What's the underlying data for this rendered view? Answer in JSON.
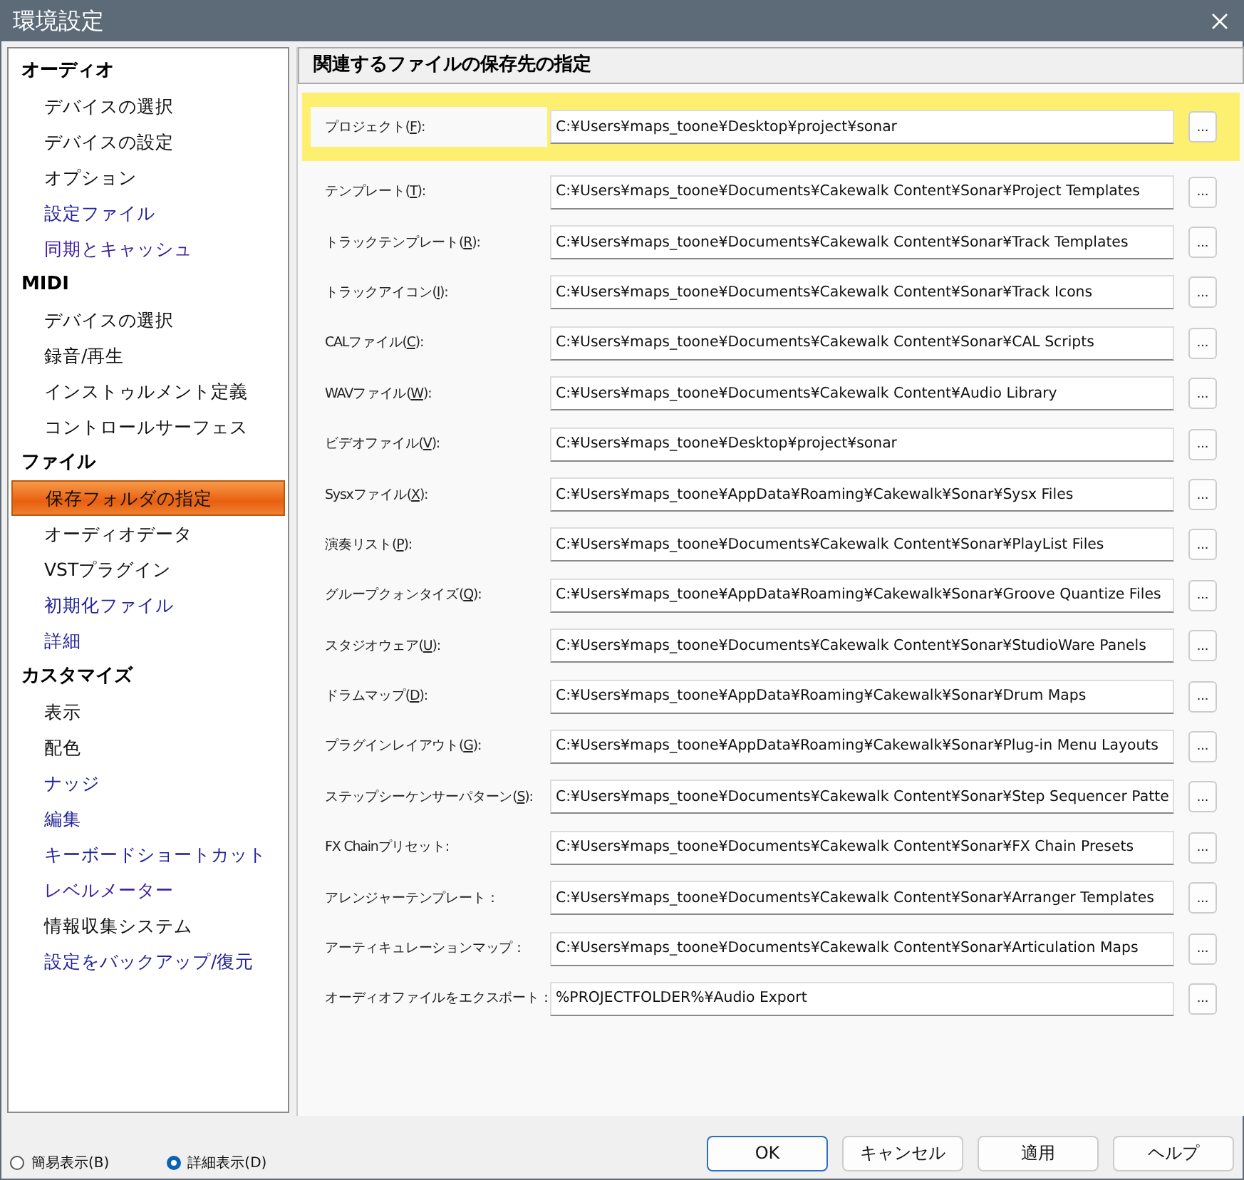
{
  "window": {
    "title": "環境設定"
  },
  "sidebar": {
    "groups": [
      {
        "label": "オーディオ",
        "items": [
          {
            "label": "デバイスの選択",
            "selected": false,
            "color": "#111111"
          },
          {
            "label": "デバイスの設定",
            "selected": false,
            "color": "#111111"
          },
          {
            "label": "オプション",
            "selected": false,
            "color": "#111111"
          },
          {
            "label": "設定ファイル",
            "selected": false,
            "color": "#22229a"
          },
          {
            "label": "同期とキャッシュ",
            "selected": false,
            "color": "#3a1a9a"
          }
        ]
      },
      {
        "label": "MIDI",
        "items": [
          {
            "label": "デバイスの選択",
            "selected": false,
            "color": "#111111"
          },
          {
            "label": "録音/再生",
            "selected": false,
            "color": "#111111"
          },
          {
            "label": "インストゥルメント定義",
            "selected": false,
            "color": "#111111"
          },
          {
            "label": "コントロールサーフェス",
            "selected": false,
            "color": "#111111"
          }
        ]
      },
      {
        "label": "ファイル",
        "items": [
          {
            "label": "保存フォルダの指定",
            "selected": true
          },
          {
            "label": "オーディオデータ",
            "selected": false,
            "color": "#111111"
          },
          {
            "label": "VSTプラグイン",
            "selected": false,
            "color": "#111111"
          },
          {
            "label": "初期化ファイル",
            "selected": false,
            "color": "#22229a"
          },
          {
            "label": "詳細",
            "selected": false,
            "color": "#22229a"
          }
        ]
      },
      {
        "label": "カスタマイズ",
        "items": [
          {
            "label": "表示",
            "selected": false,
            "color": "#111111"
          },
          {
            "label": "配色",
            "selected": false,
            "color": "#111111"
          },
          {
            "label": "ナッジ",
            "selected": false,
            "color": "#22229a"
          },
          {
            "label": "編集",
            "selected": false,
            "color": "#22229a"
          },
          {
            "label": "キーボードショートカット",
            "selected": false,
            "color": "#22229a"
          },
          {
            "label": "レベルメーター",
            "selected": false,
            "color": "#3a1a9a"
          },
          {
            "label": "情報収集システム",
            "selected": false,
            "color": "#111111"
          },
          {
            "label": "設定をバックアップ/復元",
            "selected": false,
            "color": "#22229a"
          }
        ]
      }
    ]
  },
  "panel": {
    "title": "関連するファイルの保存先の指定",
    "rows": [
      {
        "label": "プロジェクト(",
        "key": "F",
        "after": "):",
        "value": "C:¥Users¥maps_toone¥Desktop¥project¥sonar",
        "highlighted": true,
        "button": "..."
      },
      {
        "label": "テンプレート(",
        "key": "T",
        "after": "):",
        "value": "C:¥Users¥maps_toone¥Documents¥Cakewalk Content¥Sonar¥Project Templates",
        "highlighted": false,
        "button": "..."
      },
      {
        "label": "トラックテンプレート(",
        "key": "R",
        "after": "):",
        "value": "C:¥Users¥maps_toone¥Documents¥Cakewalk Content¥Sonar¥Track Templates",
        "highlighted": false,
        "button": "..."
      },
      {
        "label": "トラックアイコン(",
        "key": "I",
        "after": "):",
        "value": "C:¥Users¥maps_toone¥Documents¥Cakewalk Content¥Sonar¥Track Icons",
        "highlighted": false,
        "button": "..."
      },
      {
        "label": "CALファイル(",
        "key": "C",
        "after": "):",
        "value": "C:¥Users¥maps_toone¥Documents¥Cakewalk Content¥Sonar¥CAL Scripts",
        "highlighted": false,
        "button": "..."
      },
      {
        "label": "WAVファイル(",
        "key": "W",
        "after": "):",
        "value": "C:¥Users¥maps_toone¥Documents¥Cakewalk Content¥Audio Library",
        "highlighted": false,
        "button": "..."
      },
      {
        "label": "ビデオファイル(",
        "key": "V",
        "after": "):",
        "value": "C:¥Users¥maps_toone¥Desktop¥project¥sonar",
        "highlighted": false,
        "button": "..."
      },
      {
        "label": "Sysxファイル(",
        "key": "X",
        "after": "):",
        "value": "C:¥Users¥maps_toone¥AppData¥Roaming¥Cakewalk¥Sonar¥Sysx Files",
        "highlighted": false,
        "button": "..."
      },
      {
        "label": "演奏リスト(",
        "key": "P",
        "after": "):",
        "value": "C:¥Users¥maps_toone¥Documents¥Cakewalk Content¥Sonar¥PlayList Files",
        "highlighted": false,
        "button": "..."
      },
      {
        "label": "グループクォンタイズ(",
        "key": "Q",
        "after": "):",
        "value": "C:¥Users¥maps_toone¥AppData¥Roaming¥Cakewalk¥Sonar¥Groove Quantize Files",
        "highlighted": false,
        "button": "..."
      },
      {
        "label": "スタジオウェア(",
        "key": "U",
        "after": "):",
        "value": "C:¥Users¥maps_toone¥Documents¥Cakewalk Content¥Sonar¥StudioWare Panels",
        "highlighted": false,
        "button": "..."
      },
      {
        "label": "ドラムマップ(",
        "key": "D",
        "after": "):",
        "value": "C:¥Users¥maps_toone¥AppData¥Roaming¥Cakewalk¥Sonar¥Drum Maps",
        "highlighted": false,
        "button": "..."
      },
      {
        "label": "プラグインレイアウト(",
        "key": "G",
        "after": "):",
        "value": "C:¥Users¥maps_toone¥AppData¥Roaming¥Cakewalk¥Sonar¥Plug-in Menu Layouts",
        "highlighted": false,
        "button": "..."
      },
      {
        "label": "ステップシーケンサーパターン(",
        "key": "S",
        "after": "):",
        "value": "C:¥Users¥maps_toone¥Documents¥Cakewalk Content¥Sonar¥Step Sequencer Patte",
        "highlighted": false,
        "button": "..."
      },
      {
        "label": "FX Chainプリセット:",
        "value": "C:¥Users¥maps_toone¥Documents¥Cakewalk Content¥Sonar¥FX Chain Presets",
        "highlighted": false,
        "button": "..."
      },
      {
        "label": "アレンジャーテンプレート：",
        "value": "C:¥Users¥maps_toone¥Documents¥Cakewalk Content¥Sonar¥Arranger Templates",
        "highlighted": false,
        "button": "..."
      },
      {
        "label": "アーティキュレーションマップ：",
        "value": "C:¥Users¥maps_toone¥Documents¥Cakewalk Content¥Sonar¥Articulation Maps",
        "highlighted": false,
        "button": "..."
      },
      {
        "label": "オーディオファイルをエクスポート：",
        "value": "%PROJECTFOLDER%¥Audio Export",
        "highlighted": false,
        "button": "..."
      }
    ]
  },
  "view_modes": [
    {
      "label": "簡易表示(B)",
      "selected": false
    },
    {
      "label": "詳細表示(D)",
      "selected": true
    }
  ],
  "buttons": [
    {
      "label": "OK",
      "default": true
    },
    {
      "label": "キャンセル",
      "default": false
    },
    {
      "label": "適用",
      "default": false
    },
    {
      "label": "ヘルプ",
      "default": false
    }
  ]
}
